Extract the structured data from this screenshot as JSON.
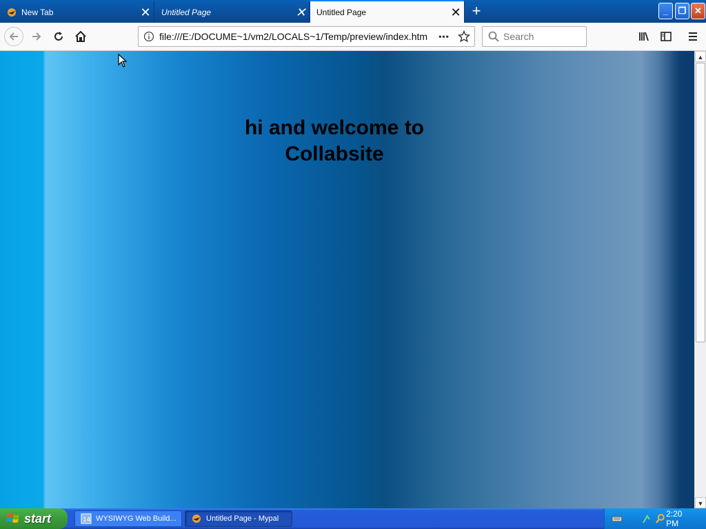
{
  "browser": {
    "tabs": [
      {
        "title": "New Tab",
        "active": false
      },
      {
        "title": "Untitled Page",
        "active": false
      },
      {
        "title": "Untitled Page",
        "active": true
      }
    ],
    "url": "file:///E:/DOCUME~1/vm2/LOCALS~1/Temp/preview/index.htm",
    "search_placeholder": "Search",
    "page_actions_label": "•••"
  },
  "page": {
    "heading_line1": "hi and welcome to",
    "heading_line2": "Collabsite"
  },
  "taskbar": {
    "start_label": "start",
    "items": [
      {
        "label": "WYSIWYG Web Build...",
        "active": false
      },
      {
        "label": "Untitled Page - Mypal",
        "active": true
      }
    ],
    "clock": "2:20 PM"
  },
  "colors": {
    "tabstrip": "#0b4f9c",
    "active_tab": "#f9f9fa",
    "taskbar": "#245edb",
    "start_green": "#3c9a3c",
    "content_gradient": [
      "#07a2e6",
      "#5fc4f4",
      "#0b69b2",
      "#06558f",
      "#7199be",
      "#0b3a6d"
    ]
  },
  "icons": [
    "back-arrow-icon",
    "forward-arrow-icon",
    "reload-icon",
    "home-icon",
    "info-icon",
    "bookmark-star-icon",
    "search-icon",
    "library-icon",
    "sidebar-icon",
    "hamburger-menu-icon",
    "close-icon",
    "new-tab-plus-icon",
    "minimize-icon",
    "maximize-icon",
    "window-close-icon",
    "windows-flag-icon",
    "mouse-cursor-icon"
  ]
}
